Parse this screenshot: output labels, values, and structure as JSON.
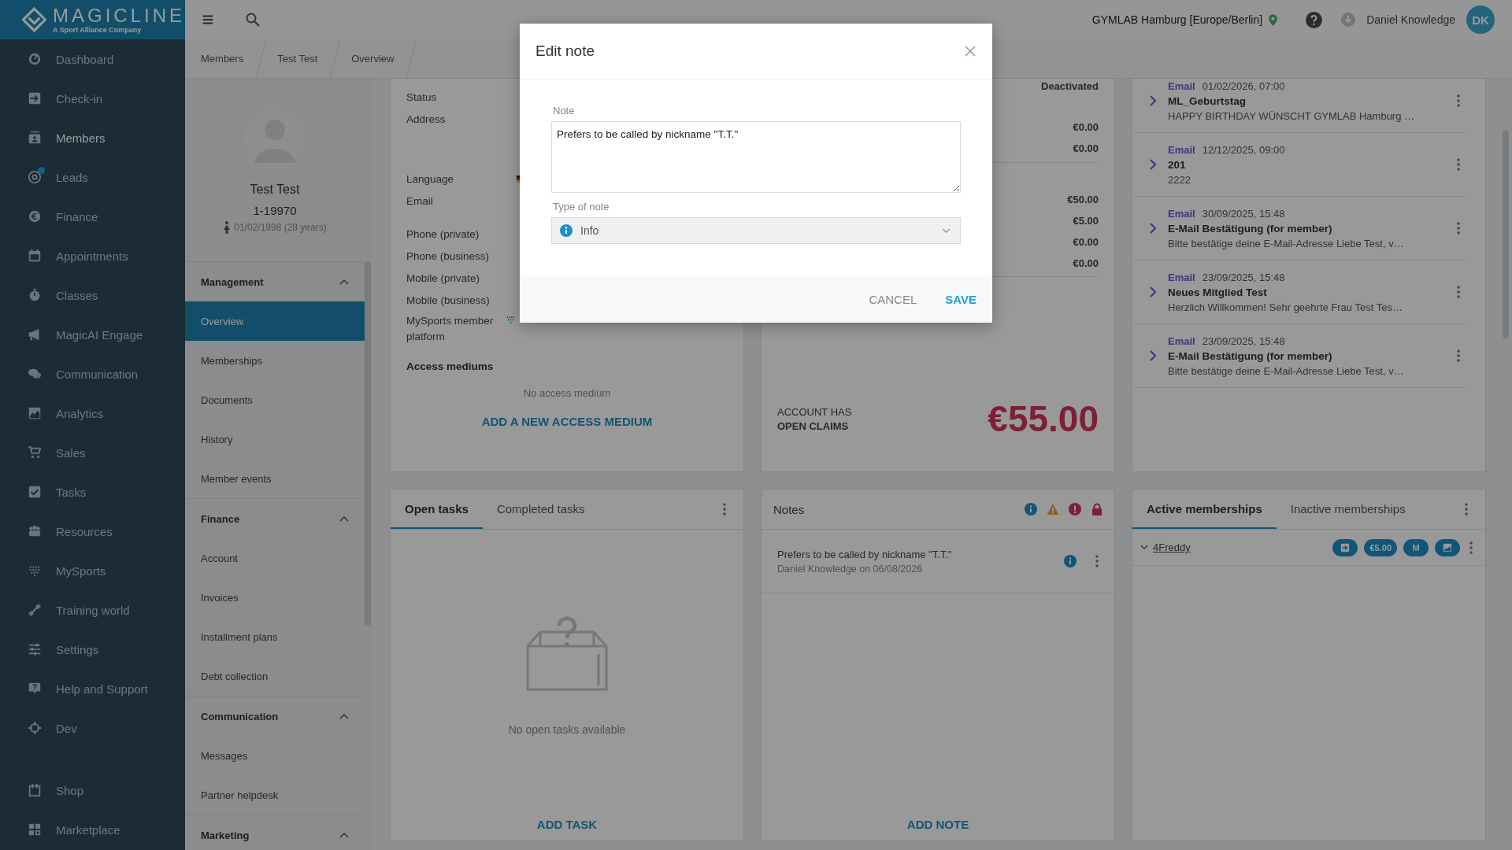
{
  "logo": {
    "name": "MAGICLINE",
    "tagline": "A Sport Alliance Company"
  },
  "nav": [
    {
      "label": "Dashboard",
      "selected": false,
      "dot": false
    },
    {
      "label": "Check-in",
      "selected": false,
      "dot": false
    },
    {
      "label": "Members",
      "selected": true,
      "dot": false
    },
    {
      "label": "Leads",
      "selected": false,
      "dot": true
    },
    {
      "label": "Finance",
      "selected": false,
      "dot": false
    },
    {
      "label": "Appointments",
      "selected": false,
      "dot": false
    },
    {
      "label": "Classes",
      "selected": false,
      "dot": false
    },
    {
      "label": "MagicAI Engage",
      "selected": false,
      "dot": false
    },
    {
      "label": "Communication",
      "selected": false,
      "dot": false
    },
    {
      "label": "Analytics",
      "selected": false,
      "dot": false
    },
    {
      "label": "Sales",
      "selected": false,
      "dot": false
    },
    {
      "label": "Tasks",
      "selected": false,
      "dot": false
    },
    {
      "label": "Resources",
      "selected": false,
      "dot": false
    },
    {
      "label": "MySports",
      "selected": false,
      "dot": false
    },
    {
      "label": "Training world",
      "selected": false,
      "dot": false
    },
    {
      "label": "Settings",
      "selected": false,
      "dot": false
    },
    {
      "label": "Help and Support",
      "selected": false,
      "dot": false
    },
    {
      "label": "Dev",
      "selected": false,
      "dot": false
    }
  ],
  "nav_bottom": [
    {
      "label": "Shop",
      "selected": false,
      "dot": false
    },
    {
      "label": "Marketplace",
      "selected": false,
      "dot": false
    }
  ],
  "topbar": {
    "location": "GYMLAB Hamburg [Europe/Berlin]",
    "user": "Daniel Knowledge",
    "initials": "DK"
  },
  "breadcrumbs": [
    "Members",
    "Test Test",
    "Overview"
  ],
  "member": {
    "name": "Test Test",
    "number": "1-19970",
    "birth": "01/02/1998 (28 years)"
  },
  "member_menu": [
    {
      "title": "Management",
      "expanded": true,
      "items": [
        {
          "label": "Overview",
          "selected": true
        },
        {
          "label": "Memberships",
          "selected": false
        },
        {
          "label": "Documents",
          "selected": false
        },
        {
          "label": "History",
          "selected": false
        },
        {
          "label": "Member events",
          "selected": false
        }
      ]
    },
    {
      "title": "Finance",
      "expanded": true,
      "items": [
        {
          "label": "Account",
          "selected": false
        },
        {
          "label": "Invoices",
          "selected": false
        },
        {
          "label": "Installment plans",
          "selected": false
        },
        {
          "label": "Debt collection",
          "selected": false
        }
      ]
    },
    {
      "title": "Communication",
      "expanded": true,
      "items": [
        {
          "label": "Messages",
          "selected": false
        },
        {
          "label": "Partner helpdesk",
          "selected": false
        }
      ]
    },
    {
      "title": "Marketing",
      "expanded": true
    }
  ],
  "details": [
    {
      "label": "Status",
      "kind": "text"
    },
    {
      "label": "Address",
      "kind": "multiline"
    },
    {
      "label": "Language",
      "kind": "flag"
    },
    {
      "label": "Email",
      "kind": "text"
    },
    {
      "label": "Phone (private)",
      "kind": "text"
    },
    {
      "label": "Phone (business)",
      "kind": "text"
    },
    {
      "label": "Mobile (private)",
      "kind": "text"
    },
    {
      "label": "Mobile (business)",
      "kind": "text"
    },
    {
      "label": "MySports member platform",
      "kind": "mysports"
    }
  ],
  "access": {
    "title": "Access mediums",
    "empty": "No access medium",
    "action": "ADD A NEW ACCESS MEDIUM"
  },
  "account": {
    "status": "Deactivated",
    "group_1": [
      "€0.00",
      "€0.00"
    ],
    "group_2": [
      "€50.00",
      "€5.00",
      "€0.00",
      "€0.00"
    ],
    "claims_line_1": "ACCOUNT HAS",
    "claims_line_2": "OPEN CLAIMS",
    "total": "€55.00"
  },
  "communications": [
    {
      "channel": "Email",
      "date": "01/02/2026, 07:00",
      "subject": "ML_Geburtstag",
      "preview": "HAPPY BIRTHDAY WÜNSCHT GYMLAB Hamburg …"
    },
    {
      "channel": "Email",
      "date": "12/12/2025, 09:00",
      "subject": "201",
      "preview": "2222"
    },
    {
      "channel": "Email",
      "date": "30/09/2025, 15:48",
      "subject": "E-Mail Bestätigung (for member)",
      "preview": "Bitte bestätige deine E-Mail-Adresse Liebe Test, v…"
    },
    {
      "channel": "Email",
      "date": "23/09/2025, 15:48",
      "subject": "Neues Mitglied Test",
      "preview": "Herzlich Willkommen! Sehr geehrte Frau Test Tes…"
    },
    {
      "channel": "Email",
      "date": "23/09/2025, 15:48",
      "subject": "E-Mail Bestätigung (for member)",
      "preview": "Bitte bestätige deine E-Mail-Adresse Liebe Test, v…"
    }
  ],
  "tasks": {
    "tabs": [
      {
        "label": "Open tasks",
        "selected": true
      },
      {
        "label": "Completed tasks",
        "selected": false
      }
    ],
    "empty": "No open tasks available",
    "action": "ADD TASK"
  },
  "notes": {
    "title": "Notes",
    "items": [
      {
        "text": "Prefers to be called by nickname \"T.T.\"",
        "author": "Daniel Knowledge on 06/08/2026",
        "kind": "info"
      }
    ],
    "action": "ADD NOTE"
  },
  "memberships": {
    "tabs": [
      {
        "label": "Active memberships",
        "selected": true
      },
      {
        "label": "Inactive memberships",
        "selected": false
      }
    ],
    "items": [
      {
        "name": "4Freddy",
        "price": "€5.00",
        "letter": "M"
      }
    ]
  },
  "dialog": {
    "title": "Edit note",
    "note_label": "Note",
    "note_value": "Prefers to be called by nickname \"T.T.\"",
    "type_label": "Type of note",
    "type_value": "Info",
    "cancel": "CANCEL",
    "save": "SAVE"
  }
}
